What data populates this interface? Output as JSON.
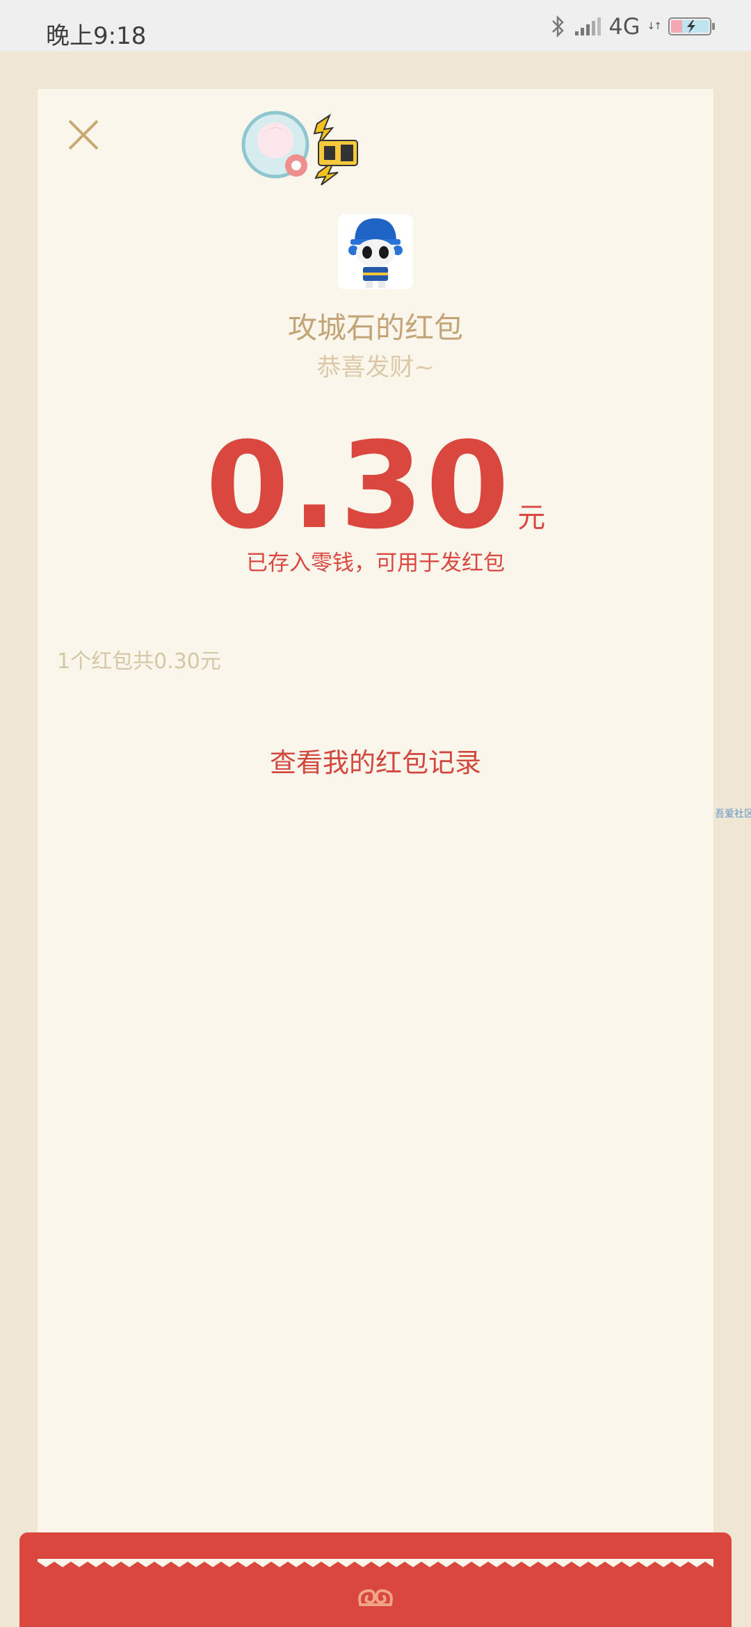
{
  "status_bar": {
    "time": "晚上9:18",
    "network": "4G",
    "icons": [
      "bluetooth-icon",
      "signal-icon",
      "battery-charging-icon"
    ]
  },
  "card": {
    "close_icon": "close-icon",
    "sender_title": "攻城石的红包",
    "blessing": "恭喜发财~",
    "amount": "0.30",
    "unit": "元",
    "stored_note": "已存入零钱，可用于发红包",
    "summary": "1个红包共0.30元",
    "record_link": "查看我的红包记录"
  },
  "watermark": "吾爱社区",
  "colors": {
    "background": "#efe6d4",
    "card": "#faf6ec",
    "gold_text": "#c3a477",
    "red": "#d9473e"
  }
}
